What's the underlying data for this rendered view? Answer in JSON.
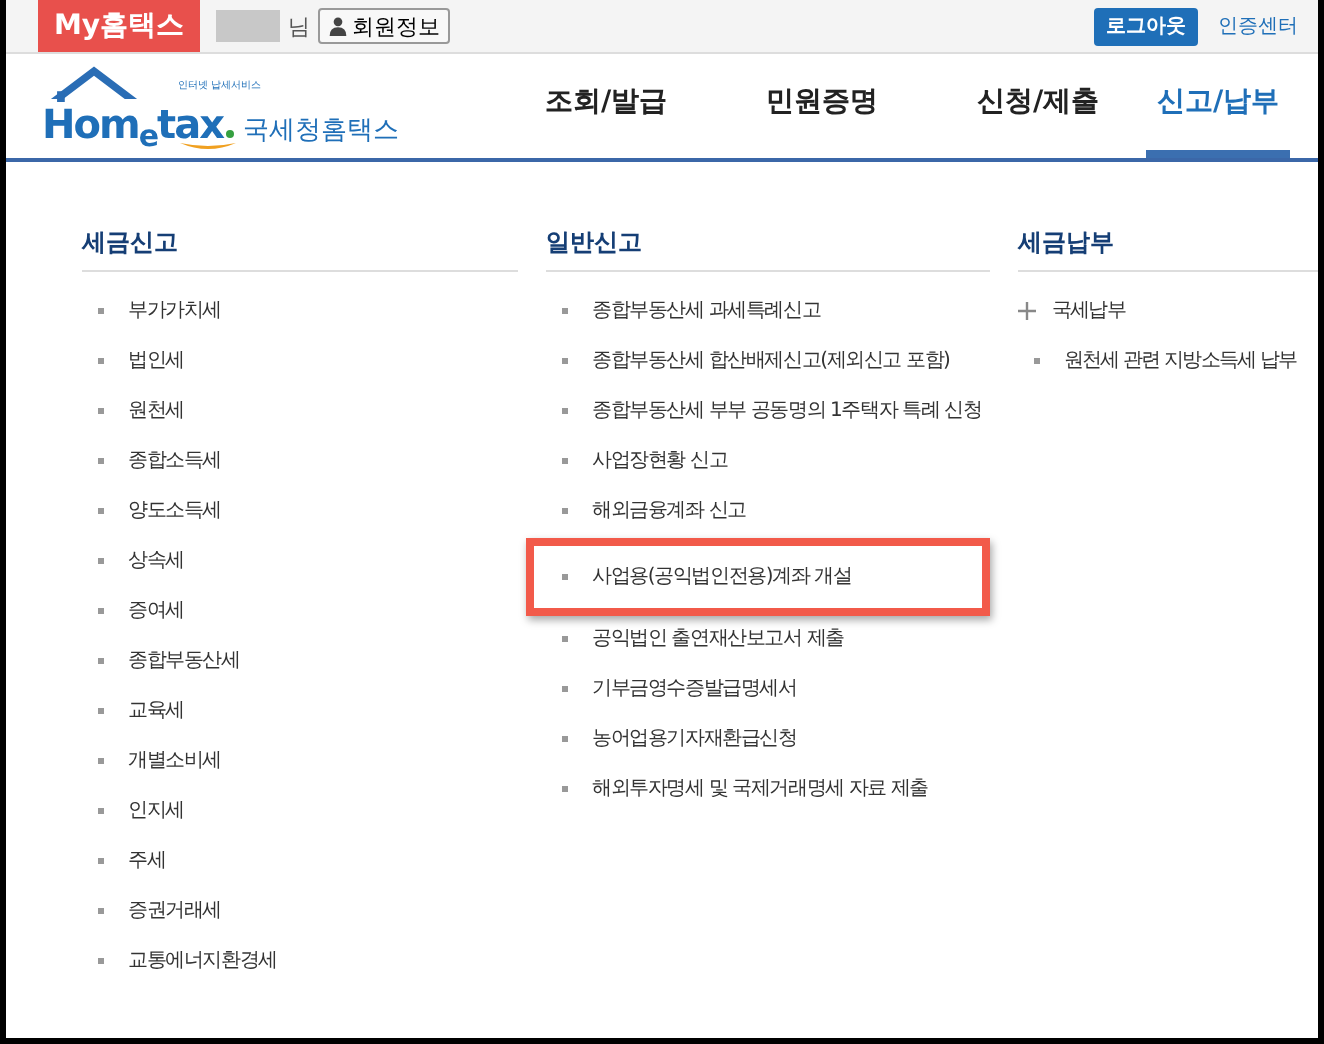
{
  "top_bar": {
    "my_button": "My홈택스",
    "user_suffix": "님",
    "member_button": "회원정보",
    "logout_button": "로그아웃",
    "cert_link": "인증센터"
  },
  "logo": {
    "tagline": "인터넷 납세서비스",
    "wordmark_start": "Hom",
    "wordmark_e": "e",
    "wordmark_end": "tax",
    "name": "국세청홈택스"
  },
  "nav": [
    {
      "label": "조회/발급",
      "selected": false
    },
    {
      "label": "민원증명",
      "selected": false
    },
    {
      "label": "신청/제출",
      "selected": false
    },
    {
      "label": "신고/납부",
      "selected": true
    }
  ],
  "columns": [
    {
      "heading": "세금신고",
      "items": [
        {
          "label": "부가가치세",
          "kind": "link",
          "highlighted": false
        },
        {
          "label": "법인세",
          "kind": "link",
          "highlighted": false
        },
        {
          "label": "원천세",
          "kind": "link",
          "highlighted": false
        },
        {
          "label": "종합소득세",
          "kind": "link",
          "highlighted": false
        },
        {
          "label": "양도소득세",
          "kind": "link",
          "highlighted": false
        },
        {
          "label": "상속세",
          "kind": "link",
          "highlighted": false
        },
        {
          "label": "증여세",
          "kind": "link",
          "highlighted": false
        },
        {
          "label": "종합부동산세",
          "kind": "link",
          "highlighted": false
        },
        {
          "label": "교육세",
          "kind": "link",
          "highlighted": false
        },
        {
          "label": "개별소비세",
          "kind": "link",
          "highlighted": false
        },
        {
          "label": "인지세",
          "kind": "link",
          "highlighted": false
        },
        {
          "label": "주세",
          "kind": "link",
          "highlighted": false
        },
        {
          "label": "증권거래세",
          "kind": "link",
          "highlighted": false
        },
        {
          "label": "교통에너지환경세",
          "kind": "link",
          "highlighted": false
        }
      ]
    },
    {
      "heading": "일반신고",
      "items": [
        {
          "label": "종합부동산세 과세특례신고",
          "kind": "link",
          "highlighted": false
        },
        {
          "label": "종합부동산세 합산배제신고(제외신고 포함)",
          "kind": "link",
          "highlighted": false
        },
        {
          "label": "종합부동산세 부부 공동명의 1주택자 특례 신청",
          "kind": "link",
          "highlighted": false
        },
        {
          "label": "사업장현황 신고",
          "kind": "link",
          "highlighted": false
        },
        {
          "label": "해외금융계좌 신고",
          "kind": "link",
          "highlighted": false
        },
        {
          "label": "사업용(공익법인전용)계좌 개설",
          "kind": "link",
          "highlighted": true
        },
        {
          "label": "공익법인 출연재산보고서 제출",
          "kind": "link",
          "highlighted": false
        },
        {
          "label": "기부금영수증발급명세서",
          "kind": "link",
          "highlighted": false
        },
        {
          "label": "농어업용기자재환급신청",
          "kind": "link",
          "highlighted": false
        },
        {
          "label": "해외투자명세 및 국제거래명세 자료 제출",
          "kind": "link",
          "highlighted": false
        }
      ]
    },
    {
      "heading": "세금납부",
      "items": [
        {
          "label": "국세납부",
          "kind": "expand",
          "highlighted": false
        },
        {
          "label": "원천세 관련 지방소득세 납부",
          "kind": "link",
          "highlighted": false
        }
      ]
    }
  ]
}
